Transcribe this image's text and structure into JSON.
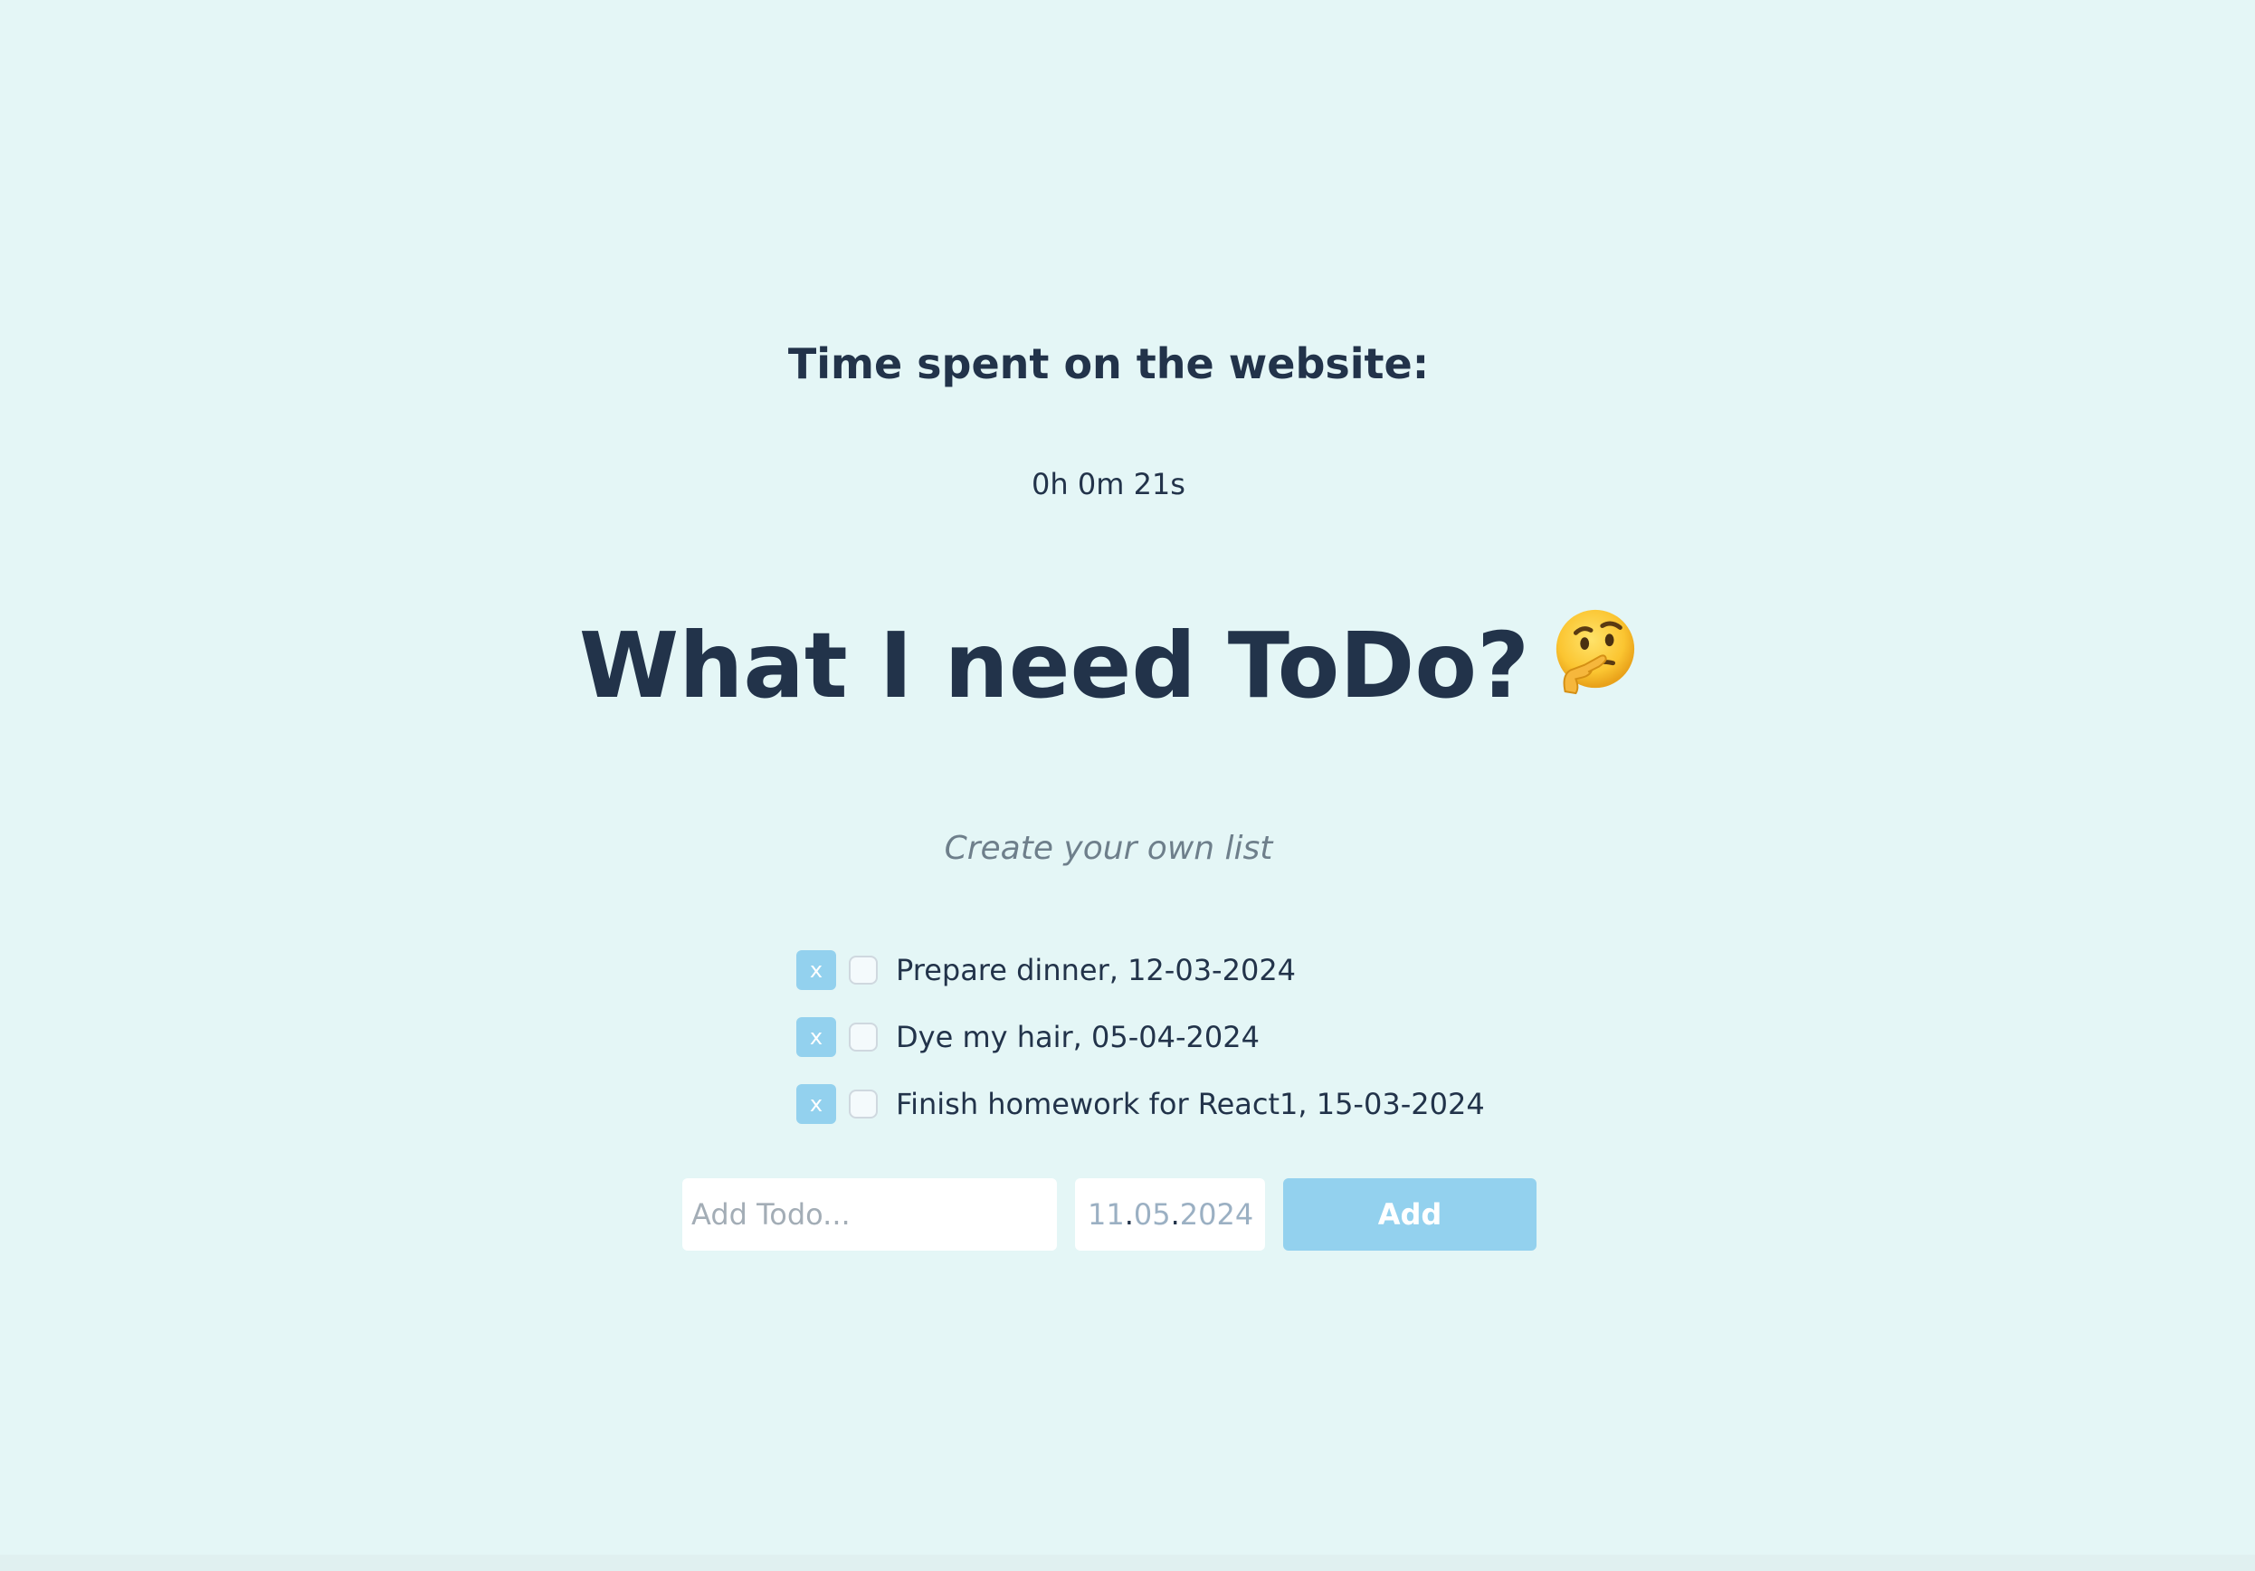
{
  "timer": {
    "title": "Time spent on the website:",
    "value": "0h 0m 21s"
  },
  "heading": {
    "title": "What I need ToDo?",
    "emoji_icon": "thinking-face-icon"
  },
  "subtitle": "Create your own list",
  "todos": [
    {
      "remove_label": "x",
      "checked": false,
      "text": "Prepare dinner, 12-03-2024"
    },
    {
      "remove_label": "x",
      "checked": false,
      "text": "Dye my hair, 05-04-2024"
    },
    {
      "remove_label": "x",
      "checked": false,
      "text": "Finish homework for React1, 15-03-2024"
    }
  ],
  "form": {
    "todo_placeholder": "Add Todo...",
    "date_day": "11",
    "date_month": "05",
    "date_year": "2024",
    "date_separator": ".",
    "add_label": "Add"
  },
  "colors": {
    "background": "#e4f6f6",
    "accent": "#93d1ee",
    "text": "#22334a",
    "muted": "#6e7f8b"
  }
}
